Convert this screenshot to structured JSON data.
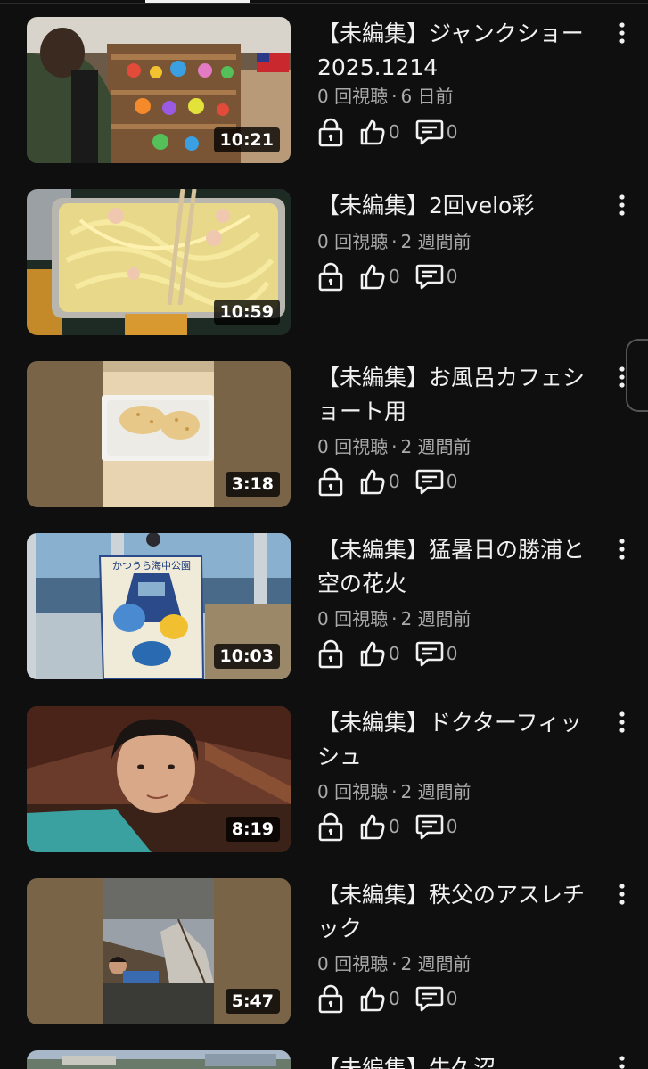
{
  "videos": [
    {
      "title_line1": "【未編集】ジャンクショー",
      "title_line2": "2025.1214",
      "views": "0 回視聴",
      "age": "6 日前",
      "duration": "10:21",
      "likes": "0",
      "comments": "0"
    },
    {
      "title_line1": "【未編集】2回velo彩",
      "title_line2": "",
      "views": "0 回視聴",
      "age": "2 週間前",
      "duration": "10:59",
      "likes": "0",
      "comments": "0"
    },
    {
      "title_line1": "【未編集】お風呂カフェシ",
      "title_line2": "ョート用",
      "views": "0 回視聴",
      "age": "2 週間前",
      "duration": "3:18",
      "likes": "0",
      "comments": "0"
    },
    {
      "title_line1": "【未編集】猛暑日の勝浦と",
      "title_line2": "空の花火",
      "views": "0 回視聴",
      "age": "2 週間前",
      "duration": "10:03",
      "likes": "0",
      "comments": "0"
    },
    {
      "title_line1": "【未編集】ドクターフィッ",
      "title_line2": "シュ",
      "views": "0 回視聴",
      "age": "2 週間前",
      "duration": "8:19",
      "likes": "0",
      "comments": "0"
    },
    {
      "title_line1": "【未編集】秩父のアスレチ",
      "title_line2": "ック",
      "views": "0 回視聴",
      "age": "2 週間前",
      "duration": "5:47",
      "likes": "0",
      "comments": "0"
    },
    {
      "title_line1": "【未編集】牛久沼",
      "title_line2": "",
      "views": "",
      "age": "",
      "duration": "",
      "likes": "",
      "comments": ""
    }
  ],
  "thumbnail_sign": "かつうら海中公園",
  "icons": {
    "visibility": "lock-icon",
    "likes": "thumb-up-icon",
    "comments": "comment-icon",
    "menu": "more-vert-icon"
  },
  "colors": {
    "background": "#0f0f0f",
    "text": "#f1f1f1",
    "secondary": "#aaaaaa"
  }
}
